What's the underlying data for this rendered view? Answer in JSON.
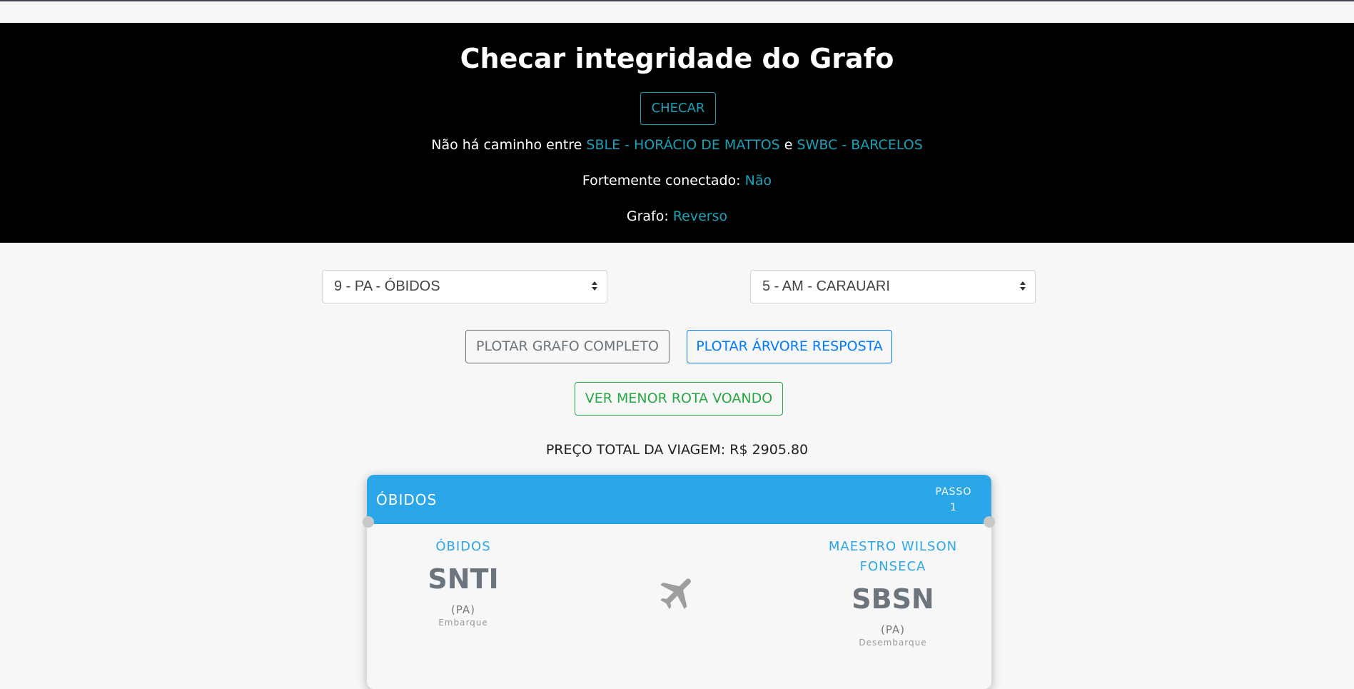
{
  "header": {
    "title": "Checar integridade do Grafo",
    "check_button": "CHECAR",
    "path_prefix": "Não há caminho entre ",
    "path_from": "SBLE - HORÁCIO DE MATTOS",
    "path_and": " e ",
    "path_to": "SWBC - BARCELOS",
    "strongly_label": "Fortemente conectado: ",
    "strongly_value": "Não",
    "graph_label": "Grafo: ",
    "graph_value": "Reverso"
  },
  "selects": {
    "origin": "9 - PA - ÓBIDOS",
    "destination": "5 - AM - CARAUARI"
  },
  "actions": {
    "plot_full": "PLOTAR GRAFO COMPLETO",
    "plot_tree": "PLOTAR ÁRVORE RESPOSTA",
    "shortest": "VER MENOR ROTA VOANDO"
  },
  "price": "PREÇO TOTAL DA VIAGEM: R$ 2905.80",
  "ticket": {
    "city": "ÓBIDOS",
    "step_label": "PASSO",
    "step_number": "1",
    "from": {
      "name": "ÓBIDOS",
      "code": "SNTI",
      "state": "(PA)",
      "role": "Embarque"
    },
    "to": {
      "name_line1": "MAESTRO WILSON",
      "name_line2": "FONSECA",
      "code": "SBSN",
      "state": "(PA)",
      "role": "Desembarque"
    },
    "icon": "airplane-icon"
  },
  "colors": {
    "accent": "#17a2b8",
    "ticket_blue": "#2ba6e8",
    "grey": "#6c757d",
    "blue": "#007bff",
    "green": "#28a745"
  }
}
